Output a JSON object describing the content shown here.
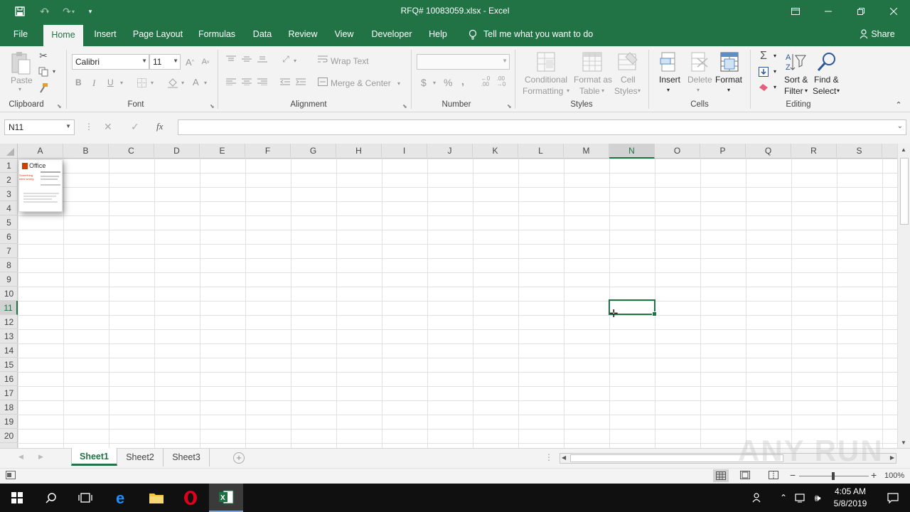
{
  "window": {
    "title": "RFQ# 10083059.xlsx  -  Excel",
    "minimize_icon": "minimize-icon",
    "restore_icon": "restore-icon",
    "close_icon": "close-icon"
  },
  "ribbon_tabs": [
    "File",
    "Home",
    "Insert",
    "Page Layout",
    "Formulas",
    "Data",
    "Review",
    "View",
    "Developer",
    "Help"
  ],
  "active_tab": "Home",
  "tell_me": "Tell me what you want to do",
  "share": "Share",
  "clipboard": {
    "paste": "Paste",
    "label": "Clipboard"
  },
  "font": {
    "name": "Calibri",
    "size": "11",
    "bold": "B",
    "italic": "I",
    "underline": "U",
    "label": "Font"
  },
  "alignment": {
    "wrap": "Wrap Text",
    "merge": "Merge & Center",
    "label": "Alignment"
  },
  "number": {
    "format": "",
    "currency": "$",
    "percent": "%",
    "comma": ",",
    "label": "Number"
  },
  "styles": {
    "conditional_1": "Conditional",
    "conditional_2": "Formatting",
    "format_table_1": "Format as",
    "format_table_2": "Table",
    "cell_styles_1": "Cell",
    "cell_styles_2": "Styles",
    "label": "Styles"
  },
  "cells": {
    "insert": "Insert",
    "delete": "Delete",
    "format": "Format",
    "label": "Cells"
  },
  "editing": {
    "sort_1": "Sort &",
    "sort_2": "Filter",
    "find_1": "Find &",
    "find_2": "Select",
    "label": "Editing"
  },
  "formula_bar": {
    "name_box": "N11",
    "formula": "",
    "fx": "fx"
  },
  "columns": [
    "A",
    "B",
    "C",
    "D",
    "E",
    "F",
    "G",
    "H",
    "I",
    "J",
    "K",
    "L",
    "M",
    "N",
    "O",
    "P",
    "Q",
    "R",
    "S"
  ],
  "rows": [
    "1",
    "2",
    "3",
    "4",
    "5",
    "6",
    "7",
    "8",
    "9",
    "10",
    "11",
    "12",
    "13",
    "14",
    "15",
    "16",
    "17",
    "18",
    "19",
    "20"
  ],
  "selected_column": "N",
  "selected_row": "11",
  "embedded_picture": {
    "logo_text": "Office",
    "line_1": "Something went wrong"
  },
  "sheets": [
    "Sheet1",
    "Sheet2",
    "Sheet3"
  ],
  "active_sheet": "Sheet1",
  "status": {
    "zoom": "100%"
  },
  "taskbar": {
    "time": "4:05 AM",
    "date": "5/8/2019"
  },
  "watermark": "ANY RUN",
  "colors": {
    "accent": "#217346",
    "ribbon_bg": "#f3f3f3",
    "taskbar": "#101010"
  }
}
